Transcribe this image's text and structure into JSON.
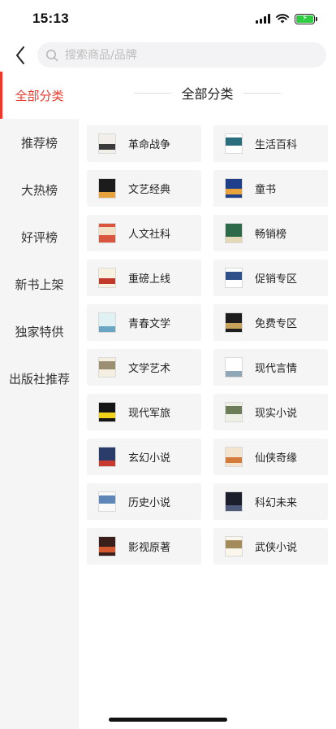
{
  "status": {
    "time": "15:13"
  },
  "search": {
    "placeholder": "搜索商品/品牌"
  },
  "sidebar": {
    "items": [
      {
        "label": "全部分类",
        "active": true
      },
      {
        "label": "推荐榜",
        "active": false
      },
      {
        "label": "大热榜",
        "active": false
      },
      {
        "label": "好评榜",
        "active": false
      },
      {
        "label": "新书上架",
        "active": false
      },
      {
        "label": "独家特供",
        "active": false
      },
      {
        "label": "出版社推荐",
        "active": false
      }
    ]
  },
  "main": {
    "title": "全部分类",
    "categories": [
      {
        "label": "革命战争",
        "colors": [
          "#f2efe8",
          "#3b3b3b"
        ]
      },
      {
        "label": "生活百科",
        "colors": [
          "#ffffff",
          "#2a6d7c"
        ]
      },
      {
        "label": "文艺经典",
        "colors": [
          "#1c1c1c",
          "#e6a23c"
        ]
      },
      {
        "label": "童书",
        "colors": [
          "#1f3f8a",
          "#e8a33a"
        ]
      },
      {
        "label": "人文社科",
        "colors": [
          "#d9553d",
          "#f2e1c7"
        ]
      },
      {
        "label": "畅销榜",
        "colors": [
          "#2d6a4a",
          "#e3d9b6"
        ]
      },
      {
        "label": "重磅上线",
        "colors": [
          "#f8f1e0",
          "#c0392b"
        ]
      },
      {
        "label": "促销专区",
        "colors": [
          "#ffffff",
          "#2e4f8a"
        ]
      },
      {
        "label": "青春文学",
        "colors": [
          "#dff1f3",
          "#6aa6c4"
        ]
      },
      {
        "label": "免费专区",
        "colors": [
          "#1d1d1d",
          "#c8a15a"
        ]
      },
      {
        "label": "文学艺术",
        "colors": [
          "#f4efe1",
          "#9b8f73"
        ]
      },
      {
        "label": "现代言情",
        "colors": [
          "#ffffff",
          "#8fa7b6"
        ]
      },
      {
        "label": "现代军旅",
        "colors": [
          "#151515",
          "#f0d21a"
        ]
      },
      {
        "label": "现实小说",
        "colors": [
          "#eef0e6",
          "#6b7e58"
        ]
      },
      {
        "label": "玄幻小说",
        "colors": [
          "#2a3d6a",
          "#c73a2f"
        ]
      },
      {
        "label": "仙侠奇缘",
        "colors": [
          "#f2e4cf",
          "#d27b3a"
        ]
      },
      {
        "label": "历史小说",
        "colors": [
          "#fafafa",
          "#5e87b8"
        ]
      },
      {
        "label": "科幻未来",
        "colors": [
          "#1b1f2c",
          "#4d5a7a"
        ]
      },
      {
        "label": "影视原著",
        "colors": [
          "#3a1f1a",
          "#d4592f"
        ]
      },
      {
        "label": "武侠小说",
        "colors": [
          "#faf6ec",
          "#a38b5a"
        ]
      }
    ]
  },
  "icons": {
    "back": "chevron-left-icon",
    "search": "search-icon",
    "signal": "signal-icon",
    "wifi": "wifi-icon",
    "battery": "battery-charging-icon"
  },
  "theme": {
    "accent": "#e8392c",
    "sidebar_bg": "#f5f5f5",
    "card_bg": "#f5f5f5",
    "battery": "#2ecc40"
  }
}
